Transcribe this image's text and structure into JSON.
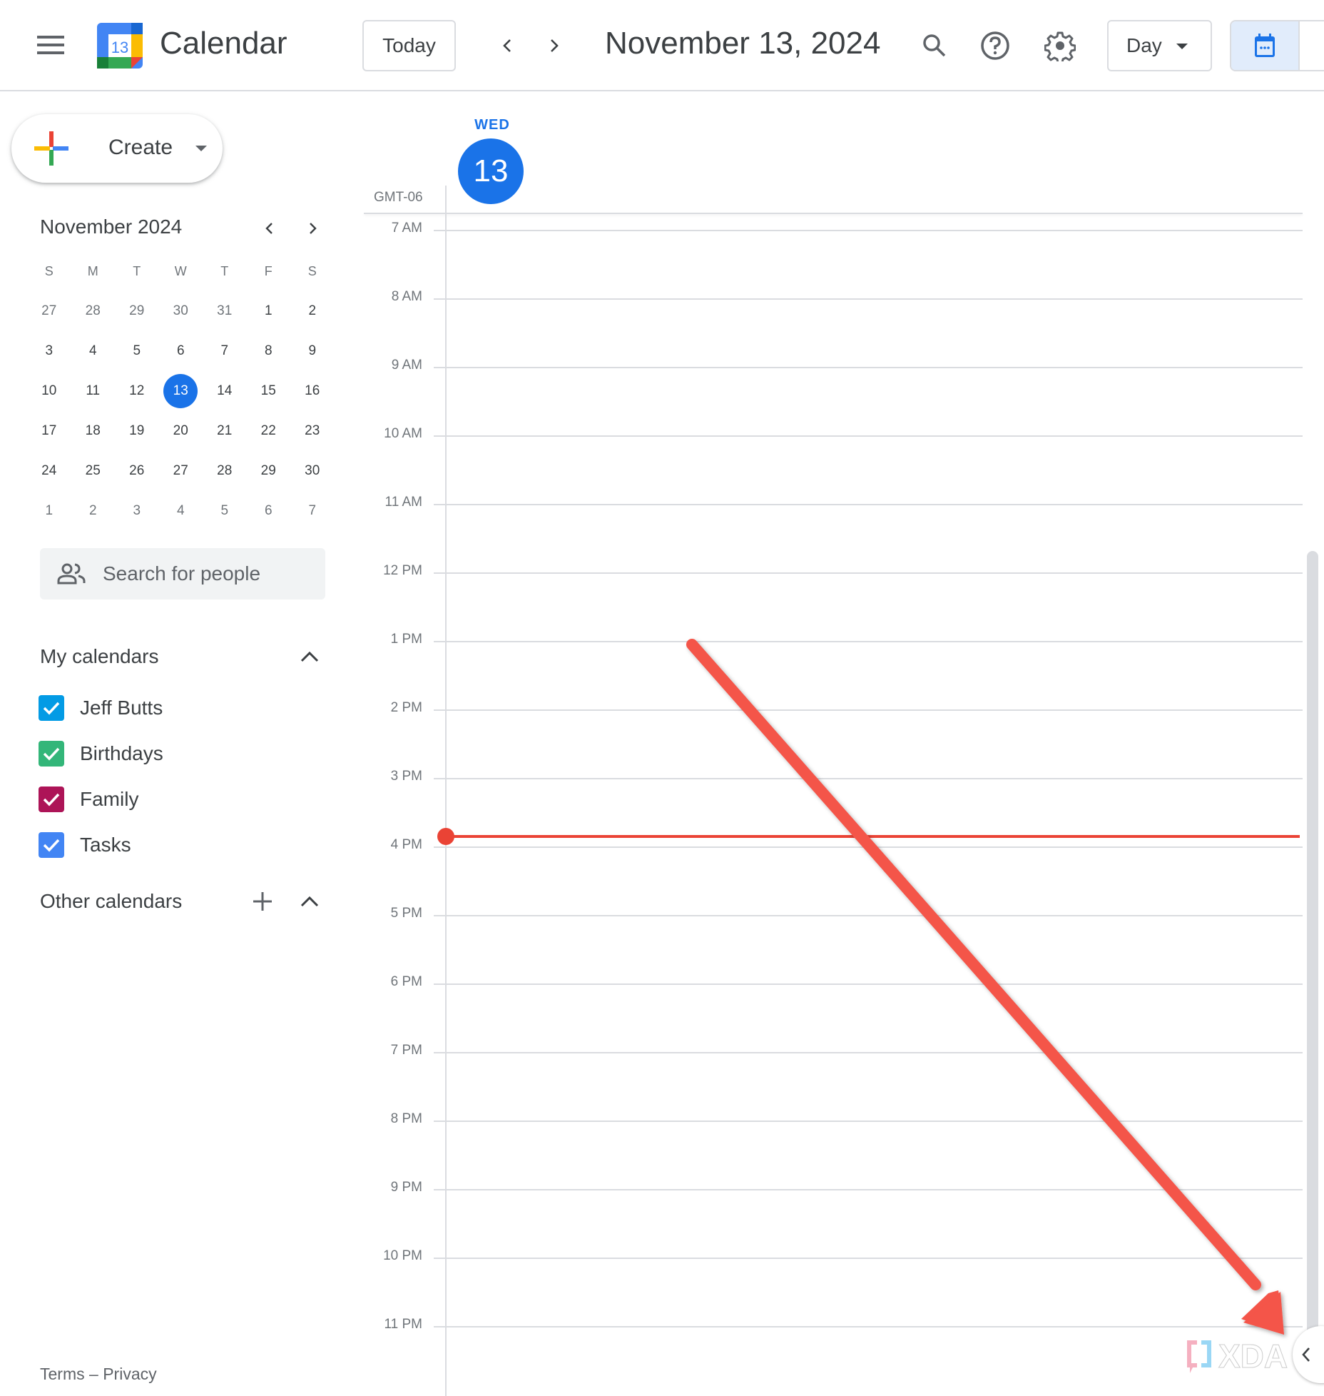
{
  "header": {
    "menu_icon": "hamburger-menu-icon",
    "logo_day": "13",
    "app_title": "Calendar",
    "today_label": "Today",
    "prev_icon": "chevron-left-icon",
    "next_icon": "chevron-right-icon",
    "date_title": "November 13, 2024",
    "search_icon": "search-icon",
    "help_icon": "help-icon",
    "settings_icon": "gear-icon",
    "view_select": "Day",
    "view_toggle_active": "calendar-icon"
  },
  "sidebar": {
    "create_label": "Create",
    "mini_calendar": {
      "title": "November 2024",
      "weekdays": [
        "S",
        "M",
        "T",
        "W",
        "T",
        "F",
        "S"
      ],
      "weeks": [
        [
          {
            "d": "27",
            "other": true
          },
          {
            "d": "28",
            "other": true
          },
          {
            "d": "29",
            "other": true
          },
          {
            "d": "30",
            "other": true
          },
          {
            "d": "31",
            "other": true
          },
          {
            "d": "1"
          },
          {
            "d": "2"
          }
        ],
        [
          {
            "d": "3"
          },
          {
            "d": "4"
          },
          {
            "d": "5"
          },
          {
            "d": "6"
          },
          {
            "d": "7"
          },
          {
            "d": "8"
          },
          {
            "d": "9"
          }
        ],
        [
          {
            "d": "10"
          },
          {
            "d": "11"
          },
          {
            "d": "12"
          },
          {
            "d": "13",
            "today": true
          },
          {
            "d": "14"
          },
          {
            "d": "15"
          },
          {
            "d": "16"
          }
        ],
        [
          {
            "d": "17"
          },
          {
            "d": "18"
          },
          {
            "d": "19"
          },
          {
            "d": "20"
          },
          {
            "d": "21"
          },
          {
            "d": "22"
          },
          {
            "d": "23"
          }
        ],
        [
          {
            "d": "24"
          },
          {
            "d": "25"
          },
          {
            "d": "26"
          },
          {
            "d": "27"
          },
          {
            "d": "28"
          },
          {
            "d": "29"
          },
          {
            "d": "30"
          }
        ],
        [
          {
            "d": "1",
            "other": true
          },
          {
            "d": "2",
            "other": true
          },
          {
            "d": "3",
            "other": true
          },
          {
            "d": "4",
            "other": true
          },
          {
            "d": "5",
            "other": true
          },
          {
            "d": "6",
            "other": true
          },
          {
            "d": "7",
            "other": true
          }
        ]
      ]
    },
    "people_search_placeholder": "Search for people",
    "my_calendars_title": "My calendars",
    "my_calendars": [
      {
        "name": "Jeff Butts",
        "color": "#039be5",
        "checked": true
      },
      {
        "name": "Birthdays",
        "color": "#33b679",
        "checked": true
      },
      {
        "name": "Family",
        "color": "#ad1457",
        "checked": true
      },
      {
        "name": "Tasks",
        "color": "#4285f4",
        "checked": true
      }
    ],
    "other_calendars_title": "Other calendars",
    "footer": {
      "terms": "Terms",
      "separator": "–",
      "privacy": "Privacy"
    }
  },
  "day_view": {
    "day_of_week": "WED",
    "day_number": "13",
    "timezone": "GMT-06",
    "hours": [
      "7 AM",
      "8 AM",
      "9 AM",
      "10 AM",
      "11 AM",
      "12 PM",
      "1 PM",
      "2 PM",
      "3 PM",
      "4 PM",
      "5 PM",
      "6 PM",
      "7 PM",
      "8 PM",
      "9 PM",
      "10 PM",
      "11 PM"
    ],
    "current_time_marker": "between 3 PM and 4 PM (just before 4 PM)"
  },
  "annotation": {
    "arrow_color": "#f4544a",
    "arrow_target": "side-panel-toggle",
    "watermark": "XDA"
  },
  "colors": {
    "accent": "#1a73e8",
    "now_line": "#ea4335",
    "grid": "#dadce0"
  }
}
